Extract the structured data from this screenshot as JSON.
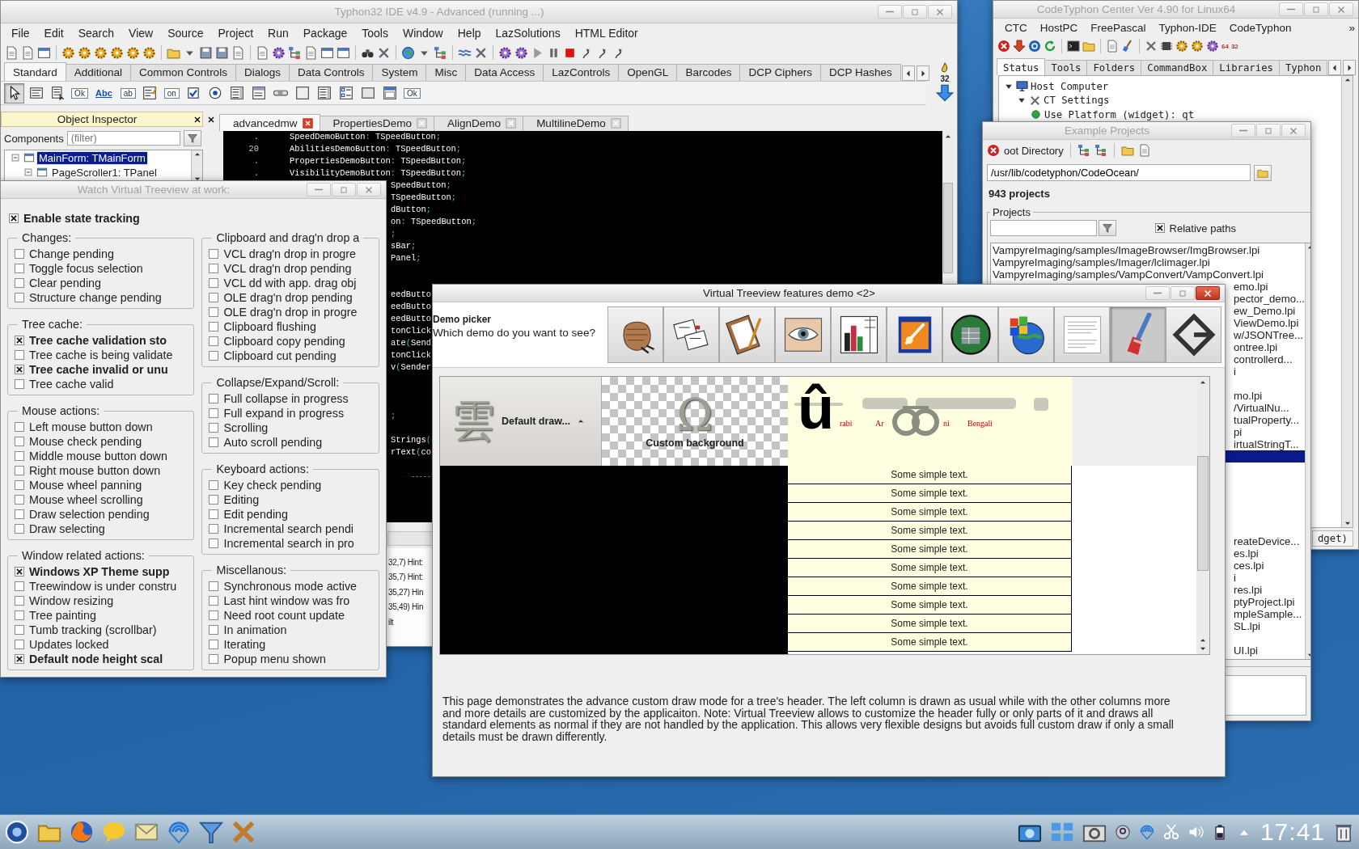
{
  "ide": {
    "title": "Typhon32 IDE v4.9 - Advanced (running ...)",
    "active": false,
    "menu": [
      "File",
      "Edit",
      "Search",
      "View",
      "Source",
      "Project",
      "Run",
      "Package",
      "Tools",
      "Window",
      "Help",
      "LazSolutions",
      "HTML Editor"
    ],
    "palette_tabs": [
      {
        "label": "Standard",
        "selected": true
      },
      {
        "label": "Additional",
        "selected": false
      },
      {
        "label": "Common Controls",
        "selected": false
      },
      {
        "label": "Dialogs",
        "selected": false
      },
      {
        "label": "Data Controls",
        "selected": false
      },
      {
        "label": "System",
        "selected": false
      },
      {
        "label": "Misc",
        "selected": false
      },
      {
        "label": "Data Access",
        "selected": false
      },
      {
        "label": "LazControls",
        "selected": false
      },
      {
        "label": "OpenGL",
        "selected": false
      },
      {
        "label": "Barcodes",
        "selected": false
      },
      {
        "label": "DCP Ciphers",
        "selected": false
      },
      {
        "label": "DCP Hashes",
        "selected": false
      }
    ],
    "palette": [
      {
        "kind": "pointer",
        "selected": true
      },
      {
        "kind": "menu",
        "selected": false
      },
      {
        "kind": "popup",
        "selected": false
      },
      {
        "kind": "button",
        "text": "Ok",
        "selected": false
      },
      {
        "kind": "label",
        "text": "Abc",
        "selected": false
      },
      {
        "kind": "edit",
        "text": "ab",
        "selected": false
      },
      {
        "kind": "memo",
        "selected": false
      },
      {
        "kind": "toggle",
        "text": "on",
        "selected": false
      },
      {
        "kind": "check",
        "selected": false
      },
      {
        "kind": "radio",
        "selected": false
      },
      {
        "kind": "listbox",
        "selected": false
      },
      {
        "kind": "combo",
        "selected": false
      },
      {
        "kind": "scrollbar",
        "selected": false
      },
      {
        "kind": "groupbox",
        "selected": false
      },
      {
        "kind": "listbox",
        "selected": false
      },
      {
        "kind": "checklist",
        "selected": false
      },
      {
        "kind": "panel",
        "selected": false
      },
      {
        "kind": "frame",
        "selected": false
      },
      {
        "kind": "button",
        "text": "Ok",
        "selected": false
      }
    ],
    "palette_badge": "32",
    "object_inspector": {
      "title": "Object Inspector",
      "components_label": "Components",
      "filter_placeholder": "(filter)",
      "tree": [
        {
          "label": "MainForm: TMainForm",
          "selected": true,
          "expanded": true,
          "children": [
            {
              "label": "PageScroller1: TPanel",
              "selected": false,
              "expanded": true
            }
          ]
        }
      ]
    },
    "editor_tabs": [
      {
        "label": "advancedmw",
        "selected": true
      },
      {
        "label": "PropertiesDemo",
        "selected": false
      },
      {
        "label": "AlignDemo",
        "selected": false
      },
      {
        "label": "MultilineDemo",
        "selected": false
      }
    ],
    "code": [
      {
        "kind": "full",
        "number": ".",
        "text": "SpeedDemoButton: TSpeedButton;"
      },
      {
        "kind": "full",
        "number": "20",
        "text": "AbilitiesDemoButton: TSpeedButton;"
      },
      {
        "kind": "full",
        "number": ".",
        "text": "PropertiesDemoButton: TSpeedButton;"
      },
      {
        "kind": "full",
        "number": ".",
        "text": "VisibilityDemoButton: TSpeedButton;"
      },
      {
        "kind": "clipped",
        "text": "SpeedButton;"
      },
      {
        "kind": "clipped",
        "text": "TSpeedButton;"
      },
      {
        "kind": "clipped",
        "text": "dButton;"
      },
      {
        "kind": "clipped",
        "text": "on: TSpeedButton;"
      },
      {
        "kind": "clipped",
        "text": ";"
      },
      {
        "kind": "clipped",
        "text": "sBar;"
      },
      {
        "kind": "clipped",
        "text": "Panel;"
      },
      {
        "kind": "blank"
      },
      {
        "kind": "blank"
      },
      {
        "kind": "clipped",
        "text": "eedButto"
      },
      {
        "kind": "clipped",
        "text": "eedButto"
      },
      {
        "kind": "clipped",
        "text": "eedButto"
      },
      {
        "kind": "clipped",
        "text": "tonClick"
      },
      {
        "kind": "clipped",
        "text": "ate(Send"
      },
      {
        "kind": "clipped",
        "text": "tonClick"
      },
      {
        "kind": "clipped",
        "text": "v(Sender"
      },
      {
        "kind": "blank"
      },
      {
        "kind": "blank"
      },
      {
        "kind": "blank"
      },
      {
        "kind": "clipped",
        "text": ";"
      },
      {
        "kind": "blank"
      },
      {
        "kind": "clipped",
        "text": "Strings("
      },
      {
        "kind": "clipped",
        "text": "rText(co"
      },
      {
        "kind": "blank"
      },
      {
        "kind": "separator"
      },
      {
        "kind": "blank"
      },
      {
        "kind": "blank"
      },
      {
        "kind": "blank"
      }
    ],
    "messages": [
      "32,7) Hint:",
      "35,7) Hint:",
      "35,27) Hin",
      "35,49) Hin",
      "ilt"
    ]
  },
  "center": {
    "title": "CodeTyphon Center Ver 4.90 for Linux64",
    "active": false,
    "menu": [
      "CTC",
      "HostPC",
      "FreePascal",
      "Typhon-IDE",
      "CodeTyphon"
    ],
    "menu_more": "»",
    "toolbar_badges": [
      "64",
      "32"
    ],
    "tabs": [
      {
        "label": "Status",
        "selected": true
      },
      {
        "label": "Tools",
        "selected": false
      },
      {
        "label": "Folders",
        "selected": false
      },
      {
        "label": "CommandBox",
        "selected": false
      },
      {
        "label": "Libraries",
        "selected": false
      },
      {
        "label": "Typhon",
        "selected": false
      }
    ],
    "tree": [
      {
        "label": "Host Computer",
        "expanded": true,
        "children": [
          {
            "label": "CT Settings",
            "expanded": true,
            "children": [
              {
                "label": "Use Platform (widget): qt"
              }
            ]
          }
        ]
      }
    ],
    "status_fragment": "dget)"
  },
  "projects": {
    "title": "Example Projects",
    "active": false,
    "root_label": "oot Directory",
    "path": "/usr/lib/codetyphon/CodeOcean/",
    "count": "943 projects",
    "group": "Projects",
    "relative_paths": {
      "label": "Relative paths",
      "checked": true
    },
    "list": [
      {
        "kind": "full",
        "text": "VampyreImaging/samples/ImageBrowser/ImgBrowser.lpi",
        "selected": false
      },
      {
        "kind": "full",
        "text": "VampyreImaging/samples/Imager/lclimager.lpi",
        "selected": false
      },
      {
        "kind": "full",
        "text": "VampyreImaging/samples/VampConvert/VampConvert.lpi",
        "selected": false
      },
      {
        "kind": "clipped",
        "text": "emo.lpi",
        "selected": false
      },
      {
        "kind": "clipped",
        "text": "pector_demo...",
        "selected": false
      },
      {
        "kind": "clipped",
        "text": "ew_Demo.lpi",
        "selected": false
      },
      {
        "kind": "clipped",
        "text": "ViewDemo.lpi",
        "selected": false
      },
      {
        "kind": "clipped",
        "text": "w/JSONTree...",
        "selected": false
      },
      {
        "kind": "clipped",
        "text": "ontree.lpi",
        "selected": false
      },
      {
        "kind": "clipped",
        "text": "controllerd...",
        "selected": false
      },
      {
        "kind": "clipped",
        "text": "i",
        "selected": false
      },
      {
        "kind": "blank",
        "selected": false
      },
      {
        "kind": "clipped",
        "text": "mo.lpi",
        "selected": false
      },
      {
        "kind": "clipped",
        "text": "/VirtualNu...",
        "selected": false
      },
      {
        "kind": "clipped",
        "text": "tualProperty...",
        "selected": false
      },
      {
        "kind": "clipped",
        "text": "pi",
        "selected": false
      },
      {
        "kind": "clipped",
        "text": "irtualStringT...",
        "selected": false
      },
      {
        "kind": "blank",
        "selected": true
      },
      {
        "kind": "blank",
        "selected": false
      },
      {
        "kind": "blank",
        "selected": false
      },
      {
        "kind": "blank",
        "selected": false
      },
      {
        "kind": "blank",
        "selected": false
      },
      {
        "kind": "blank",
        "selected": false
      },
      {
        "kind": "blank",
        "selected": false
      },
      {
        "kind": "clipped",
        "text": "reateDevice...",
        "selected": false
      },
      {
        "kind": "clipped",
        "text": "es.lpi",
        "selected": false
      },
      {
        "kind": "clipped",
        "text": "ces.lpi",
        "selected": false
      },
      {
        "kind": "clipped",
        "text": "i",
        "selected": false
      },
      {
        "kind": "clipped",
        "text": "res.lpi",
        "selected": false
      },
      {
        "kind": "clipped",
        "text": "ptyProject.lpi",
        "selected": false
      },
      {
        "kind": "clipped",
        "text": "mpleSample...",
        "selected": false
      },
      {
        "kind": "clipped",
        "text": "SL.lpi",
        "selected": false
      },
      {
        "kind": "blank",
        "selected": false
      },
      {
        "kind": "clipped",
        "text": "UI.lpi",
        "selected": false
      }
    ]
  },
  "watch": {
    "title": "Watch Virtual Treeview at work:",
    "active": false,
    "enable": {
      "label": "Enable state tracking",
      "checked": true
    },
    "columns": [
      [
        {
          "title": "Changes:",
          "items": [
            {
              "label": "Change pending",
              "checked": false
            },
            {
              "label": "Toggle focus selection",
              "checked": false
            },
            {
              "label": "Clear pending",
              "checked": false
            },
            {
              "label": "Structure change pending",
              "checked": false
            }
          ]
        },
        {
          "title": "Tree cache:",
          "items": [
            {
              "label": "Tree cache validation sto",
              "checked": true
            },
            {
              "label": "Tree cache is being validate",
              "checked": false
            },
            {
              "label": "Tree cache invalid or unu",
              "checked": true
            },
            {
              "label": "Tree cache valid",
              "checked": false
            }
          ]
        },
        {
          "title": "Mouse actions:",
          "items": [
            {
              "label": "Left mouse button down",
              "checked": false
            },
            {
              "label": "Mouse check pending",
              "checked": false
            },
            {
              "label": "Middle mouse button down",
              "checked": false
            },
            {
              "label": "Right mouse button down",
              "checked": false
            },
            {
              "label": "Mouse wheel panning",
              "checked": false
            },
            {
              "label": "Mouse wheel scrolling",
              "checked": false
            },
            {
              "label": "Draw selection pending",
              "checked": false
            },
            {
              "label": "Draw selecting",
              "checked": false
            }
          ]
        },
        {
          "title": "Window related actions:",
          "items": [
            {
              "label": "Windows XP Theme supp",
              "checked": true
            },
            {
              "label": "Treewindow is under constru",
              "checked": false
            },
            {
              "label": "Window resizing",
              "checked": false
            },
            {
              "label": "Tree painting",
              "checked": false
            },
            {
              "label": "Tumb tracking (scrollbar)",
              "checked": false
            },
            {
              "label": "Updates locked",
              "checked": false
            },
            {
              "label": "Default node height scal",
              "checked": true
            }
          ]
        }
      ],
      [
        {
          "title": "Clipboard and drag'n drop a",
          "items": [
            {
              "label": "VCL drag'n drop in progre",
              "checked": false
            },
            {
              "label": "VCL drag'n drop pending",
              "checked": false
            },
            {
              "label": "VCL dd with app. drag obj",
              "checked": false
            },
            {
              "label": "OLE drag'n drop pending",
              "checked": false
            },
            {
              "label": "OLE drag'n drop in progre",
              "checked": false
            },
            {
              "label": "Clipboard flushing",
              "checked": false
            },
            {
              "label": "Clipboard copy pending",
              "checked": false
            },
            {
              "label": "Clipboard cut pending",
              "checked": false
            }
          ]
        },
        {
          "title": "Collapse/Expand/Scroll:",
          "items": [
            {
              "label": "Full collapse in progress",
              "checked": false
            },
            {
              "label": "Full expand in progress",
              "checked": false
            },
            {
              "label": "Scrolling",
              "checked": false
            },
            {
              "label": "Auto scroll pending",
              "checked": false
            }
          ]
        },
        {
          "title": "Keyboard actions:",
          "items": [
            {
              "label": "Key check pending",
              "checked": false
            },
            {
              "label": "Editing",
              "checked": false
            },
            {
              "label": "Edit pending",
              "checked": false
            },
            {
              "label": "Incremental search pendi",
              "checked": false
            },
            {
              "label": "Incremental search in pro",
              "checked": false
            }
          ]
        },
        {
          "title": "Miscellanous:",
          "items": [
            {
              "label": "Synchronous mode active",
              "checked": false
            },
            {
              "label": "Last hint window was fro",
              "checked": false
            },
            {
              "label": "Need root count update",
              "checked": false
            },
            {
              "label": "In animation",
              "checked": false
            },
            {
              "label": "Iterating",
              "checked": false
            },
            {
              "label": "Popup menu shown",
              "checked": false
            }
          ]
        }
      ]
    ]
  },
  "demo": {
    "title": "Virtual Treeview features demo <2>",
    "active": true,
    "picker_title": "Demo picker",
    "picker_prompt": "Which demo do you want to see?",
    "buttons": [
      {
        "kind": "fist",
        "selected": false
      },
      {
        "kind": "papers",
        "selected": false
      },
      {
        "kind": "clipboard",
        "selected": false
      },
      {
        "kind": "eye",
        "selected": false
      },
      {
        "kind": "chart",
        "selected": false
      },
      {
        "kind": "paint",
        "selected": false
      },
      {
        "kind": "globe",
        "selected": false
      },
      {
        "kind": "flagglobe",
        "selected": false
      },
      {
        "kind": "page",
        "selected": false
      },
      {
        "kind": "brush",
        "selected": true
      },
      {
        "kind": "diamond",
        "selected": false
      }
    ],
    "header": [
      {
        "kind": "default",
        "emblem": "雲",
        "text": "Default draw...",
        "sorted": true
      },
      {
        "kind": "checker",
        "emblem": "Ω",
        "text": "Custom background"
      },
      {
        "kind": "scripts",
        "glyph": "û",
        "labels": [
          "rabi",
          "Ar",
          "ni",
          "Bengali"
        ]
      }
    ],
    "rows": [
      "Some simple text.",
      "Some simple text.",
      "Some simple text.",
      "Some simple text.",
      "Some simple text.",
      "Some simple text.",
      "Some simple text.",
      "Some simple text.",
      "Some simple text.",
      "Some simple text."
    ],
    "description": "This page demonstrates the advance custom draw mode for a tree's header. The left column is drawn as usual while with the other columns more and more details are customized by the applicaiton. Note: Virtual Treeview allows to customize the header fully or only parts of it and draws all standard elements as normal if they are not handled by the application. This allows very flexible designs but avoids full custom draw if only a small details must be drawn differently."
  },
  "taskbar": {
    "clock": "17:41"
  }
}
